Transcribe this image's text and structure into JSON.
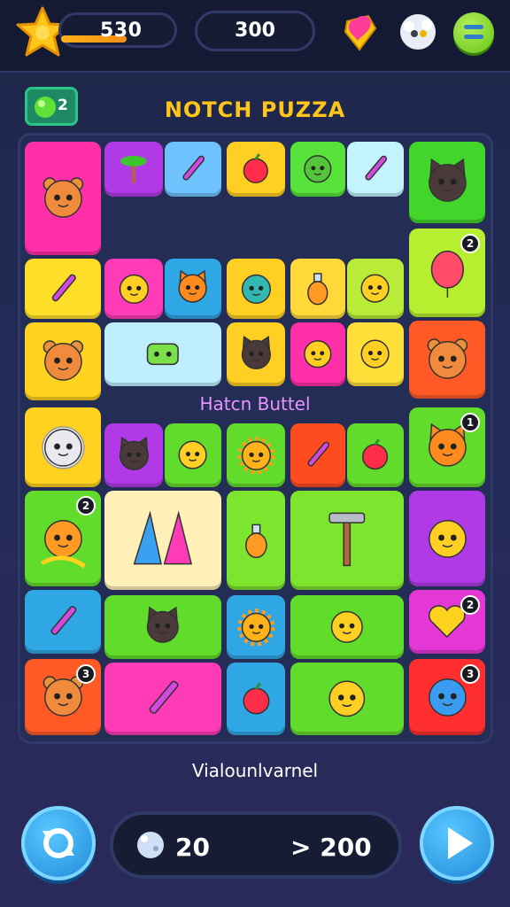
{
  "header": {
    "score": "530",
    "score_progress": 0.58,
    "coins": "300",
    "level_badge": "2",
    "title": "NOTCH PUZZA"
  },
  "board": {
    "subtitle": "Hatcn Buttel",
    "tiles": [
      {
        "id": "t1",
        "color": "#ff2fa7",
        "icon": "bear-face-icon"
      },
      {
        "id": "t2",
        "color": "#b03be6",
        "icon": "palm-tree-icon"
      },
      {
        "id": "t3",
        "color": "#6ec3ff",
        "icon": "crayon-icon"
      },
      {
        "id": "t4",
        "color": "#ffcf24",
        "icon": "apple-icon"
      },
      {
        "id": "t5",
        "color": "#57e339",
        "icon": "frog-face-icon"
      },
      {
        "id": "t6",
        "color": "#c2f3ff",
        "icon": "pencil-icon"
      },
      {
        "id": "t7",
        "color": "#41d629",
        "icon": "cat-face-icon"
      },
      {
        "id": "t8",
        "color": "#ffde2a",
        "icon": "crayon-icon"
      },
      {
        "id": "t9",
        "color": "#ff3bb7",
        "icon": "banana-icon"
      },
      {
        "id": "t10",
        "color": "#2fa7e4",
        "icon": "fox-face-icon"
      },
      {
        "id": "t11",
        "color": "#ffcf24",
        "icon": "ball-face-icon"
      },
      {
        "id": "t12",
        "color": "#ffd83a",
        "icon": "bottle-icon"
      },
      {
        "id": "t13",
        "color": "#b9ec36",
        "icon": "eye-creature-icon"
      },
      {
        "id": "t14",
        "color": "#b6ef2f",
        "icon": "balloon-icon",
        "badge": "2"
      },
      {
        "id": "t15",
        "color": "#ffd21f",
        "icon": "bear-face-icon"
      },
      {
        "id": "t16",
        "color": "#bfefff",
        "icon": "robot-face-icon"
      },
      {
        "id": "t17",
        "color": "#ffcf24",
        "icon": "cat-face-icon"
      },
      {
        "id": "t18",
        "color": "#ff2fa7",
        "icon": "dragon-icon"
      },
      {
        "id": "t19",
        "color": "#ffe03a",
        "icon": "leaf-creature-icon"
      },
      {
        "id": "t20",
        "color": "#ff5a25",
        "icon": "bear-face-icon"
      },
      {
        "id": "t21",
        "color": "#ffd21f",
        "icon": "sheep-face-icon"
      },
      {
        "id": "t22",
        "color": "#b03be6",
        "icon": "cat-face-icon"
      },
      {
        "id": "t23",
        "color": "#62dc2b",
        "icon": "crown-fruit-icon"
      },
      {
        "id": "t24",
        "color": "#62dc2b",
        "icon": "sun-face-icon"
      },
      {
        "id": "t25",
        "color": "#ff4c1f",
        "icon": "pencil-icon"
      },
      {
        "id": "t26",
        "color": "#62dc2b",
        "icon": "strawberry-icon"
      },
      {
        "id": "t27",
        "color": "#62dc2b",
        "icon": "fox-face-icon",
        "badge": "1"
      },
      {
        "id": "t28",
        "color": "#62dc2b",
        "icon": "owl-face-icon",
        "badge": "2"
      },
      {
        "id": "t29",
        "color": "#fff0b8",
        "icon": "wizard-hats-icon"
      },
      {
        "id": "t30",
        "color": "#7de52e",
        "icon": "bulb-creature-icon"
      },
      {
        "id": "t31",
        "color": "#7de52e",
        "icon": "hammer-icon"
      },
      {
        "id": "t32",
        "color": "#b03be6",
        "icon": "popsicle-icon"
      },
      {
        "id": "t33",
        "color": "#2fa7e4",
        "icon": "crayon-icon"
      },
      {
        "id": "t34",
        "color": "#62dc2b",
        "icon": "cat-face-icon"
      },
      {
        "id": "t35",
        "color": "#2fa7e4",
        "icon": "sun-icon"
      },
      {
        "id": "t36",
        "color": "#62dc2b",
        "icon": "cat-pair-icon"
      },
      {
        "id": "t37",
        "color": "#e438d6",
        "icon": "heart-icon",
        "badge": "2"
      },
      {
        "id": "t38",
        "color": "#ff5a25",
        "icon": "bear-face-icon",
        "badge": "3"
      },
      {
        "id": "t39",
        "color": "#ff3bb7",
        "icon": "crayons-icon"
      },
      {
        "id": "t40",
        "color": "#2fa7e4",
        "icon": "berry-icon"
      },
      {
        "id": "t41",
        "color": "#62dc2b",
        "icon": "orange-pair-icon"
      },
      {
        "id": "t42",
        "color": "#ff2f2f",
        "icon": "octopus-icon",
        "badge": "3"
      }
    ]
  },
  "footer": {
    "caption": "Vialounlvarnel",
    "moves_left": "20",
    "target": "> 200"
  },
  "colors": {
    "title": "#ffc61a",
    "subtitle": "#e694ff",
    "accent": "#2fa7e4"
  }
}
